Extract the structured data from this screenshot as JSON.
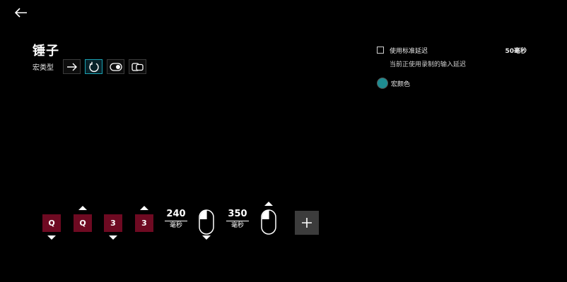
{
  "header": {
    "back_icon": "arrow-left-icon",
    "title": "锤子"
  },
  "macro_type": {
    "label": "宏类型",
    "options": [
      {
        "icon": "arrow-right-icon",
        "selected": false
      },
      {
        "icon": "repeat-loop-icon",
        "selected": true
      },
      {
        "icon": "toggle-icon",
        "selected": false
      },
      {
        "icon": "sequence-icon",
        "selected": false
      }
    ]
  },
  "settings": {
    "standard_delay_label": "使用标准延迟",
    "standard_delay_checked": false,
    "standard_delay_value": "50毫秒",
    "delay_description": "当前正使用录制的输入延迟",
    "macro_color_label": "宏颜色",
    "macro_color": "#1e8c91"
  },
  "sequence": {
    "key1": "Q",
    "key2": "Q",
    "key3": "3",
    "key4": "3",
    "delay1_value": "240",
    "delay1_unit": "毫秒",
    "delay2_value": "350",
    "delay2_unit": "毫秒",
    "key_color": "#6e0a22",
    "add_icon": "plus-icon"
  }
}
